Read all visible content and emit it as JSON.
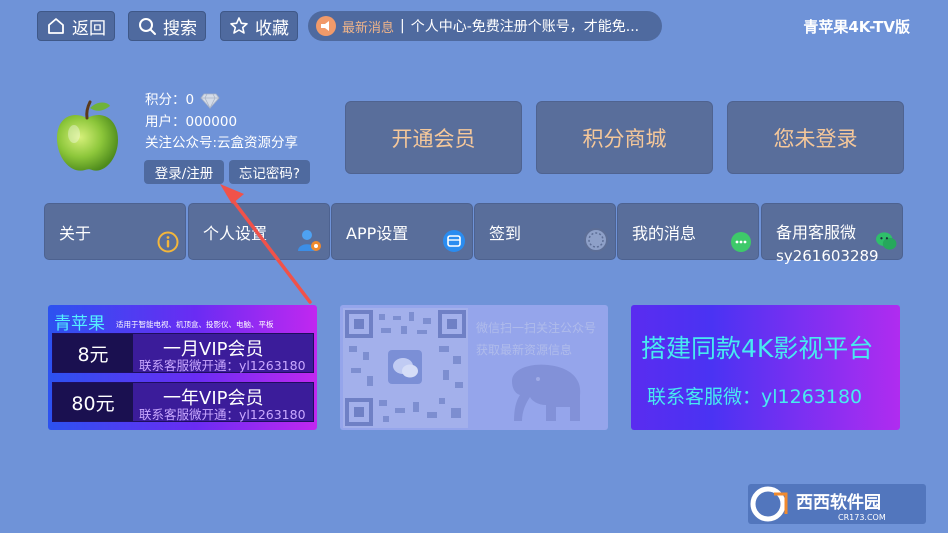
{
  "topbar": {
    "back_label": "返回",
    "search_label": "搜索",
    "favorite_label": "收藏",
    "news_tag": "最新消息",
    "news_separator": "|",
    "news_text": "个人中心-免费注册个账号，才能免...",
    "brand": "青苹果4K-TV版"
  },
  "user": {
    "points_label": "积分：0",
    "user_label": "用户：000000",
    "follow_label": "关注公众号:云盒资源分享",
    "login_button": "登录/注册",
    "forgot_button": "忘记密码?"
  },
  "big_buttons": [
    "开通会员",
    "积分商城",
    "您未登录"
  ],
  "menu": [
    {
      "label": "关于",
      "icon": "info-icon"
    },
    {
      "label": "个人设置",
      "icon": "user-settings-icon"
    },
    {
      "label": "APP设置",
      "icon": "app-settings-icon"
    },
    {
      "label": "签到",
      "icon": "checkin-icon"
    },
    {
      "label": "我的消息",
      "icon": "message-icon"
    },
    {
      "label": "备用客服微",
      "sub": "sy261603289",
      "icon": "wechat-icon"
    }
  ],
  "banner_vip": {
    "brand": "青苹果",
    "subtitle": "适用于智能电视、机顶盒、投影仪、电脑、平板",
    "plans": [
      {
        "price": "8元",
        "name": "一月VIP会员",
        "contact": "联系客服微开通：yl1263180"
      },
      {
        "price": "80元",
        "name": "一年VIP会员",
        "contact": "联系客服微开通：yl1263180"
      }
    ]
  },
  "banner_qr": {
    "line1": "微信扫一扫关注公众号",
    "line2": "获取最新资源信息"
  },
  "banner_platform": {
    "title": "搭建同款4K影视平台",
    "contact": "联系客服微：yl1263180"
  },
  "watermark": {
    "text": "西西软件园",
    "url": "CR173.COM"
  },
  "colors": {
    "background": "#6f93d8",
    "button": "#596e9b",
    "accent_text": "#f6c89a",
    "cyan_text": "#48eaf0",
    "arrow": "#f0524a"
  }
}
